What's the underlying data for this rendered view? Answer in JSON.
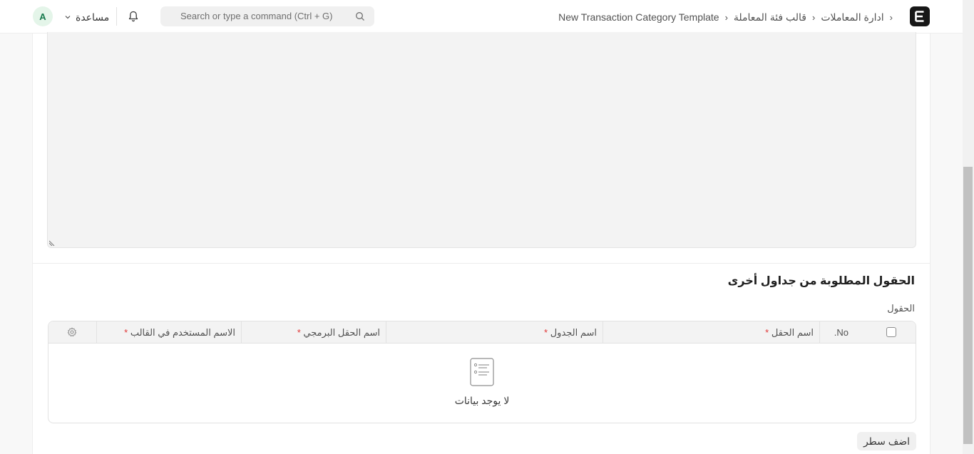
{
  "navbar": {
    "logo_letter": "E",
    "breadcrumbs": [
      {
        "label": "ادارة المعاملات"
      },
      {
        "label": "قالب فئة المعاملة"
      },
      {
        "label": "New Transaction Category Template"
      }
    ],
    "search_placeholder": "Search or type a command (Ctrl + G)",
    "help_label": "مساعدة",
    "avatar_initial": "A"
  },
  "section": {
    "title": "الحقول المطلوبة من جداول أخرى",
    "field_label": "الحقول"
  },
  "grid": {
    "columns": {
      "no": "No.",
      "field_name": "اسم الحقل",
      "table_name": "اسم الجدول",
      "fieldname": "اسم الحقل البرمجي",
      "template_name": "الاسم المستخدم في القالب"
    },
    "required_mark": "*",
    "empty_message": "لا يوجد بيانات"
  },
  "actions": {
    "add_row_label": "اضف سطر"
  },
  "colors": {
    "brand": "#171717",
    "required": "#e03636",
    "avatar_bg": "#e4f5e9",
    "avatar_text": "#16794c"
  }
}
